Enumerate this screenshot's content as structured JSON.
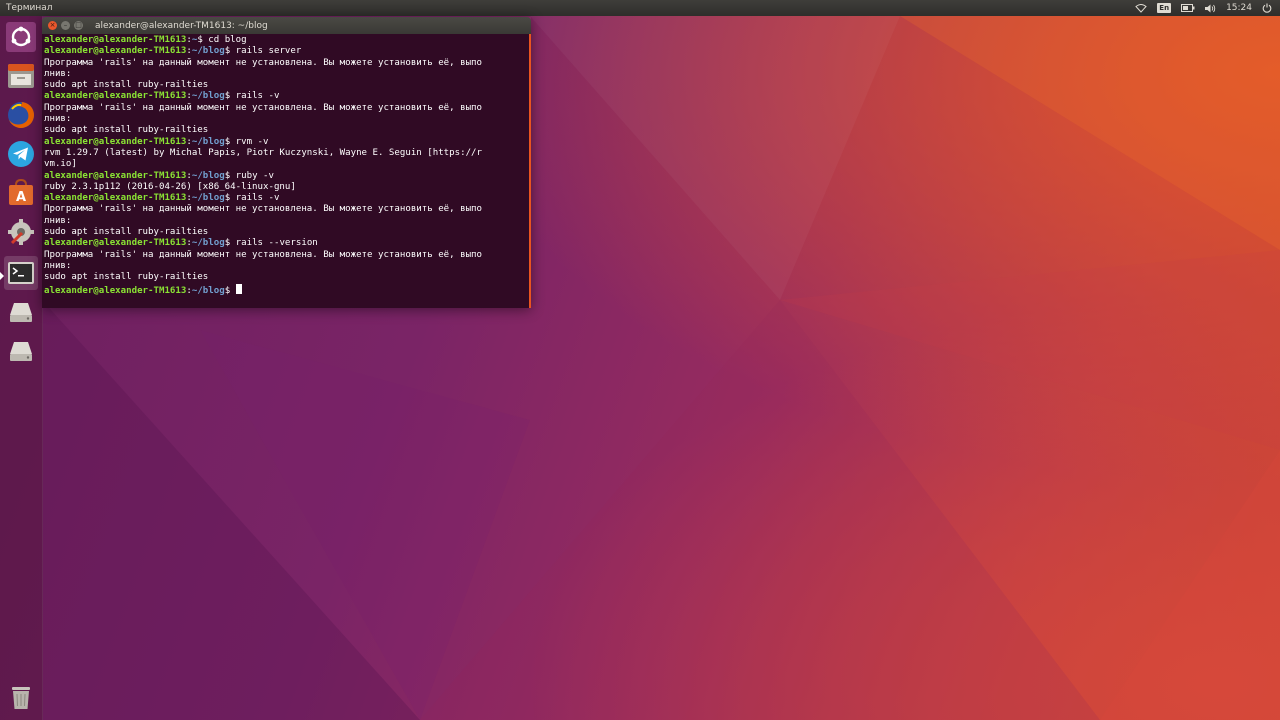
{
  "top_panel": {
    "app_name": "Терминал",
    "keyboard_layout": "En",
    "clock": "15:24",
    "icons": [
      "wifi-icon",
      "keyboard-layout-indicator",
      "battery-icon",
      "volume-icon",
      "power-icon"
    ]
  },
  "launcher": {
    "items": [
      {
        "name": "dash-home-icon"
      },
      {
        "name": "files-icon"
      },
      {
        "name": "firefox-icon"
      },
      {
        "name": "telegram-icon"
      },
      {
        "name": "ubuntu-software-icon"
      },
      {
        "name": "system-settings-icon"
      },
      {
        "name": "terminal-icon"
      },
      {
        "name": "drive-icon"
      },
      {
        "name": "drive-icon"
      },
      {
        "name": "trash-icon"
      }
    ]
  },
  "terminal": {
    "title": "alexander@alexander-TM1613: ~/blog",
    "prompt_user": "alexander@alexander-TM1613",
    "lines": [
      {
        "type": "prompt",
        "path": "~",
        "cmd": "cd blog"
      },
      {
        "type": "prompt",
        "path": "~/blog",
        "cmd": "rails server"
      },
      {
        "type": "out",
        "text": "Программа 'rails' на данный момент не установлена. Вы можете установить её, выпо"
      },
      {
        "type": "out",
        "text": "лнив:"
      },
      {
        "type": "out",
        "text": "sudo apt install ruby-railties"
      },
      {
        "type": "prompt",
        "path": "~/blog",
        "cmd": "rails -v"
      },
      {
        "type": "out",
        "text": "Программа 'rails' на данный момент не установлена. Вы можете установить её, выпо"
      },
      {
        "type": "out",
        "text": "лнив:"
      },
      {
        "type": "out",
        "text": "sudo apt install ruby-railties"
      },
      {
        "type": "prompt",
        "path": "~/blog",
        "cmd": "rvm -v"
      },
      {
        "type": "out",
        "text": "rvm 1.29.7 (latest) by Michal Papis, Piotr Kuczynski, Wayne E. Seguin [https://r"
      },
      {
        "type": "out",
        "text": "vm.io]"
      },
      {
        "type": "prompt",
        "path": "~/blog",
        "cmd": "ruby -v"
      },
      {
        "type": "out",
        "text": "ruby 2.3.1p112 (2016-04-26) [x86_64-linux-gnu]"
      },
      {
        "type": "prompt",
        "path": "~/blog",
        "cmd": "rails -v"
      },
      {
        "type": "out",
        "text": "Программа 'rails' на данный момент не установлена. Вы можете установить её, выпо"
      },
      {
        "type": "out",
        "text": "лнив:"
      },
      {
        "type": "out",
        "text": "sudo apt install ruby-railties"
      },
      {
        "type": "prompt",
        "path": "~/blog",
        "cmd": "rails --version"
      },
      {
        "type": "out",
        "text": "Программа 'rails' на данный момент не установлена. Вы можете установить её, выпо"
      },
      {
        "type": "out",
        "text": "лнив:"
      },
      {
        "type": "out",
        "text": "sudo apt install ruby-railties"
      },
      {
        "type": "prompt",
        "path": "~/blog",
        "cmd": "",
        "cursor": true
      }
    ]
  },
  "colors": {
    "terminal_bg": "#300a24",
    "prompt_user": "#8ae234",
    "prompt_path": "#729fcf",
    "accent": "#e95420"
  }
}
